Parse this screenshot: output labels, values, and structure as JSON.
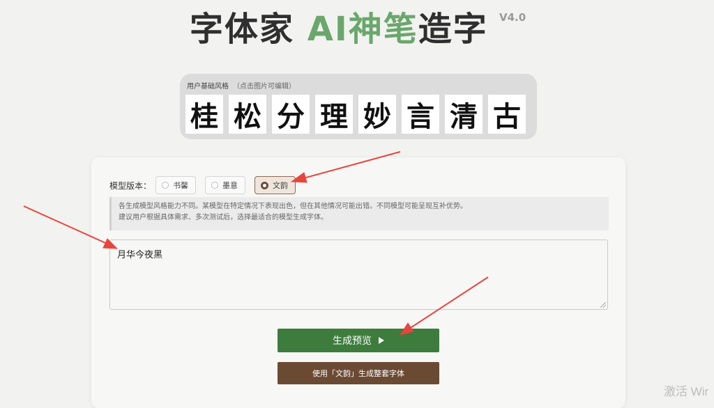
{
  "header": {
    "title_part1": "字体家 ",
    "title_part2": "AI神笔",
    "title_part3": "造字",
    "version": "V4.0",
    "accent_color": "#6aa76c"
  },
  "style_panel": {
    "label": "用户基础风格",
    "hint": "（点击图片可编辑）",
    "glyphs": [
      "桂",
      "松",
      "分",
      "理",
      "妙",
      "言",
      "清",
      "古"
    ]
  },
  "model": {
    "label": "模型版本：",
    "options": [
      "书馨",
      "墨意",
      "文韵"
    ],
    "selected": "文韵"
  },
  "notice": {
    "line1": "各生成模型风格能力不同。某模型在特定情况下表现出色，但在其他情况可能出错。不同模型可能呈现互补优势。",
    "line2": "建议用户根据具体需求、多次测试后，选择最适合的模型生成字体。"
  },
  "input": {
    "value": "月华今夜黑"
  },
  "buttons": {
    "preview": "生成预览",
    "preview_color": "#3d7c3d",
    "full": "使用「文韵」生成整套字体",
    "full_color": "#6b4a33"
  },
  "watermark": "激活 Wir"
}
